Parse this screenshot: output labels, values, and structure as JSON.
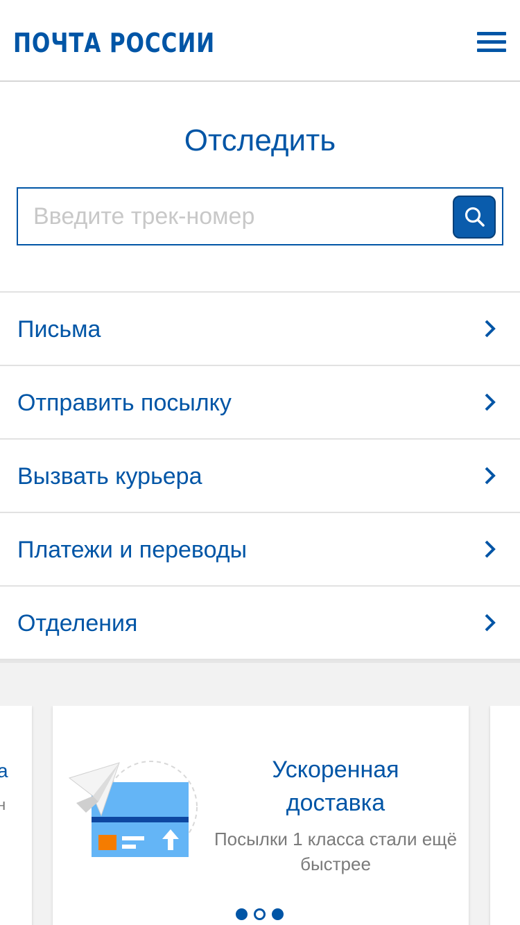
{
  "header": {
    "logo_text": "ПОЧТА РОССИИ",
    "menu_icon": "hamburger-menu-icon"
  },
  "tracking": {
    "title": "Отследить",
    "placeholder": "Введите трек-номер",
    "value": "",
    "search_icon": "search-icon"
  },
  "menu": {
    "items": [
      {
        "label": "Письма",
        "icon": "chevron-right-icon"
      },
      {
        "label": "Отправить посылку",
        "icon": "chevron-right-icon"
      },
      {
        "label": "Вызвать курьера",
        "icon": "chevron-right-icon"
      },
      {
        "label": "Платежи и переводы",
        "icon": "chevron-right-icon"
      },
      {
        "label": "Отделения",
        "icon": "chevron-right-icon"
      }
    ]
  },
  "carousel": {
    "active_card": {
      "title": "Ускоренная доставка",
      "subtitle": "Посылки 1 класса стали ещё быстрее",
      "illustration": "paper-plane-parcel-icon"
    },
    "left_peek": {
      "title": "а",
      "subtitle": "н"
    },
    "pagination": {
      "total": 3,
      "active_index": 1
    }
  },
  "colors": {
    "brand_blue": "#0055a6",
    "band_gray": "#f2f2f2",
    "accent_orange": "#f57c00",
    "illus_blue": "#64b5f6"
  }
}
